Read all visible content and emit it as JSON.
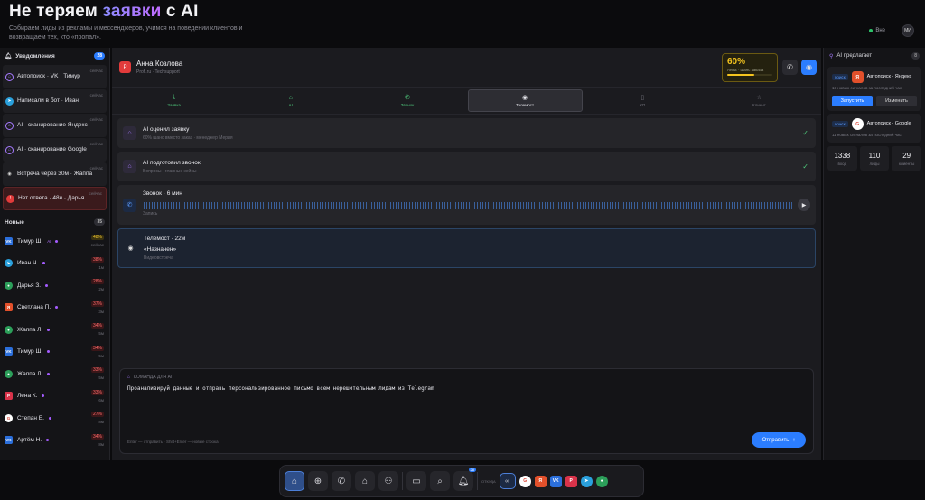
{
  "hero": {
    "title_a": "Не теряем ",
    "title_accent": "заявки",
    "title_b": " с AI",
    "subtitle": "Собираем лиды из рекламы и мессенджеров, учимся на поведении клиентов и возвращаем тех, кто «пропал».",
    "online_label": "Вне",
    "user_initials": "МИ"
  },
  "notifications": {
    "title": "Уведомления",
    "count": "28",
    "items": [
      {
        "text": "Автопоиск · VK · Тимур",
        "time": "сейчас"
      },
      {
        "text": "Написали в бот · Иван",
        "time": "сейчас"
      },
      {
        "text": "AI · сканирование Яндекс",
        "time": "сейчас"
      },
      {
        "text": "AI · сканирование Google",
        "time": "сейчас"
      },
      {
        "text": "Встреча через 30м · Жаппа",
        "time": "сейчас"
      },
      {
        "text": "Нет ответа · 48ч · Дарья",
        "time": "сейчас"
      }
    ]
  },
  "leads": {
    "title": "Новые",
    "count": "35",
    "items": [
      {
        "name": "Тимур Ш.",
        "ai": "AI",
        "pct": "48%",
        "ago": "сейчас"
      },
      {
        "name": "Иван Ч.",
        "pct": "38%",
        "ago": "1м"
      },
      {
        "name": "Дарья З.",
        "pct": "28%",
        "ago": "2м"
      },
      {
        "name": "Светлана П.",
        "pct": "37%",
        "ago": "3м"
      },
      {
        "name": "Жаппа Л.",
        "pct": "34%",
        "ago": "5м"
      },
      {
        "name": "Тимур Ш.",
        "pct": "34%",
        "ago": "5м"
      },
      {
        "name": "Жаппа Л.",
        "pct": "33%",
        "ago": "5м"
      },
      {
        "name": "Лена К.",
        "pct": "33%",
        "ago": "6м"
      },
      {
        "name": "Степан Е.",
        "pct": "27%",
        "ago": "8м"
      },
      {
        "name": "Артём Н.",
        "pct": "34%",
        "ago": "8м"
      }
    ]
  },
  "contact": {
    "name": "Анна Козлова",
    "site": "Profi.ru · Techsupport",
    "score": "60%",
    "score_label": "Анна · шанс заказа",
    "score_fraction": 0.6
  },
  "tabs": [
    {
      "label": "Заявка"
    },
    {
      "label": "AI"
    },
    {
      "label": "Звонок"
    },
    {
      "label": "Телемост"
    },
    {
      "label": "КП"
    },
    {
      "label": "Клиент"
    }
  ],
  "timeline": [
    {
      "title": "AI оценил заявку",
      "sub": "60% шанс вместо заказ · менеджер Мерия"
    },
    {
      "title": "AI подготовил звонок",
      "sub": "Вопросы · главные кейсы"
    },
    {
      "title": "Звонок · 6 мин",
      "sub": "Запись"
    },
    {
      "title": "Телемост · 22м",
      "quote": "«Назначен»",
      "sub": "Видеовстреча"
    }
  ],
  "composer": {
    "label": "КОМАНДА ДЛЯ AI",
    "text": "Проанализируй данные и отправь персонализированное письмо всем нерешительным лидам из Telegram",
    "hint": "Enter — отправить · Shift+Enter — новые строка",
    "send": "Отправить"
  },
  "ai_panel": {
    "title": "AI предлагает",
    "count": "8",
    "suggestions": [
      {
        "tag": "поиск",
        "source": "Автопоиск · Яндекс",
        "desc": "13 новых сигналов за последний час",
        "run": "Запустить",
        "edit": "Изменить"
      },
      {
        "tag": "поиск",
        "source": "Автопоиск · Google",
        "desc": "11 новых сигналов за последний час"
      }
    ],
    "stats": [
      {
        "n": "1338",
        "u": "вход"
      },
      {
        "n": "110",
        "u": "лиды"
      },
      {
        "n": "29",
        "u": "клиенты"
      }
    ]
  },
  "dock": {
    "sources_label": "ОТКУДА",
    "bell_badge": "28"
  }
}
